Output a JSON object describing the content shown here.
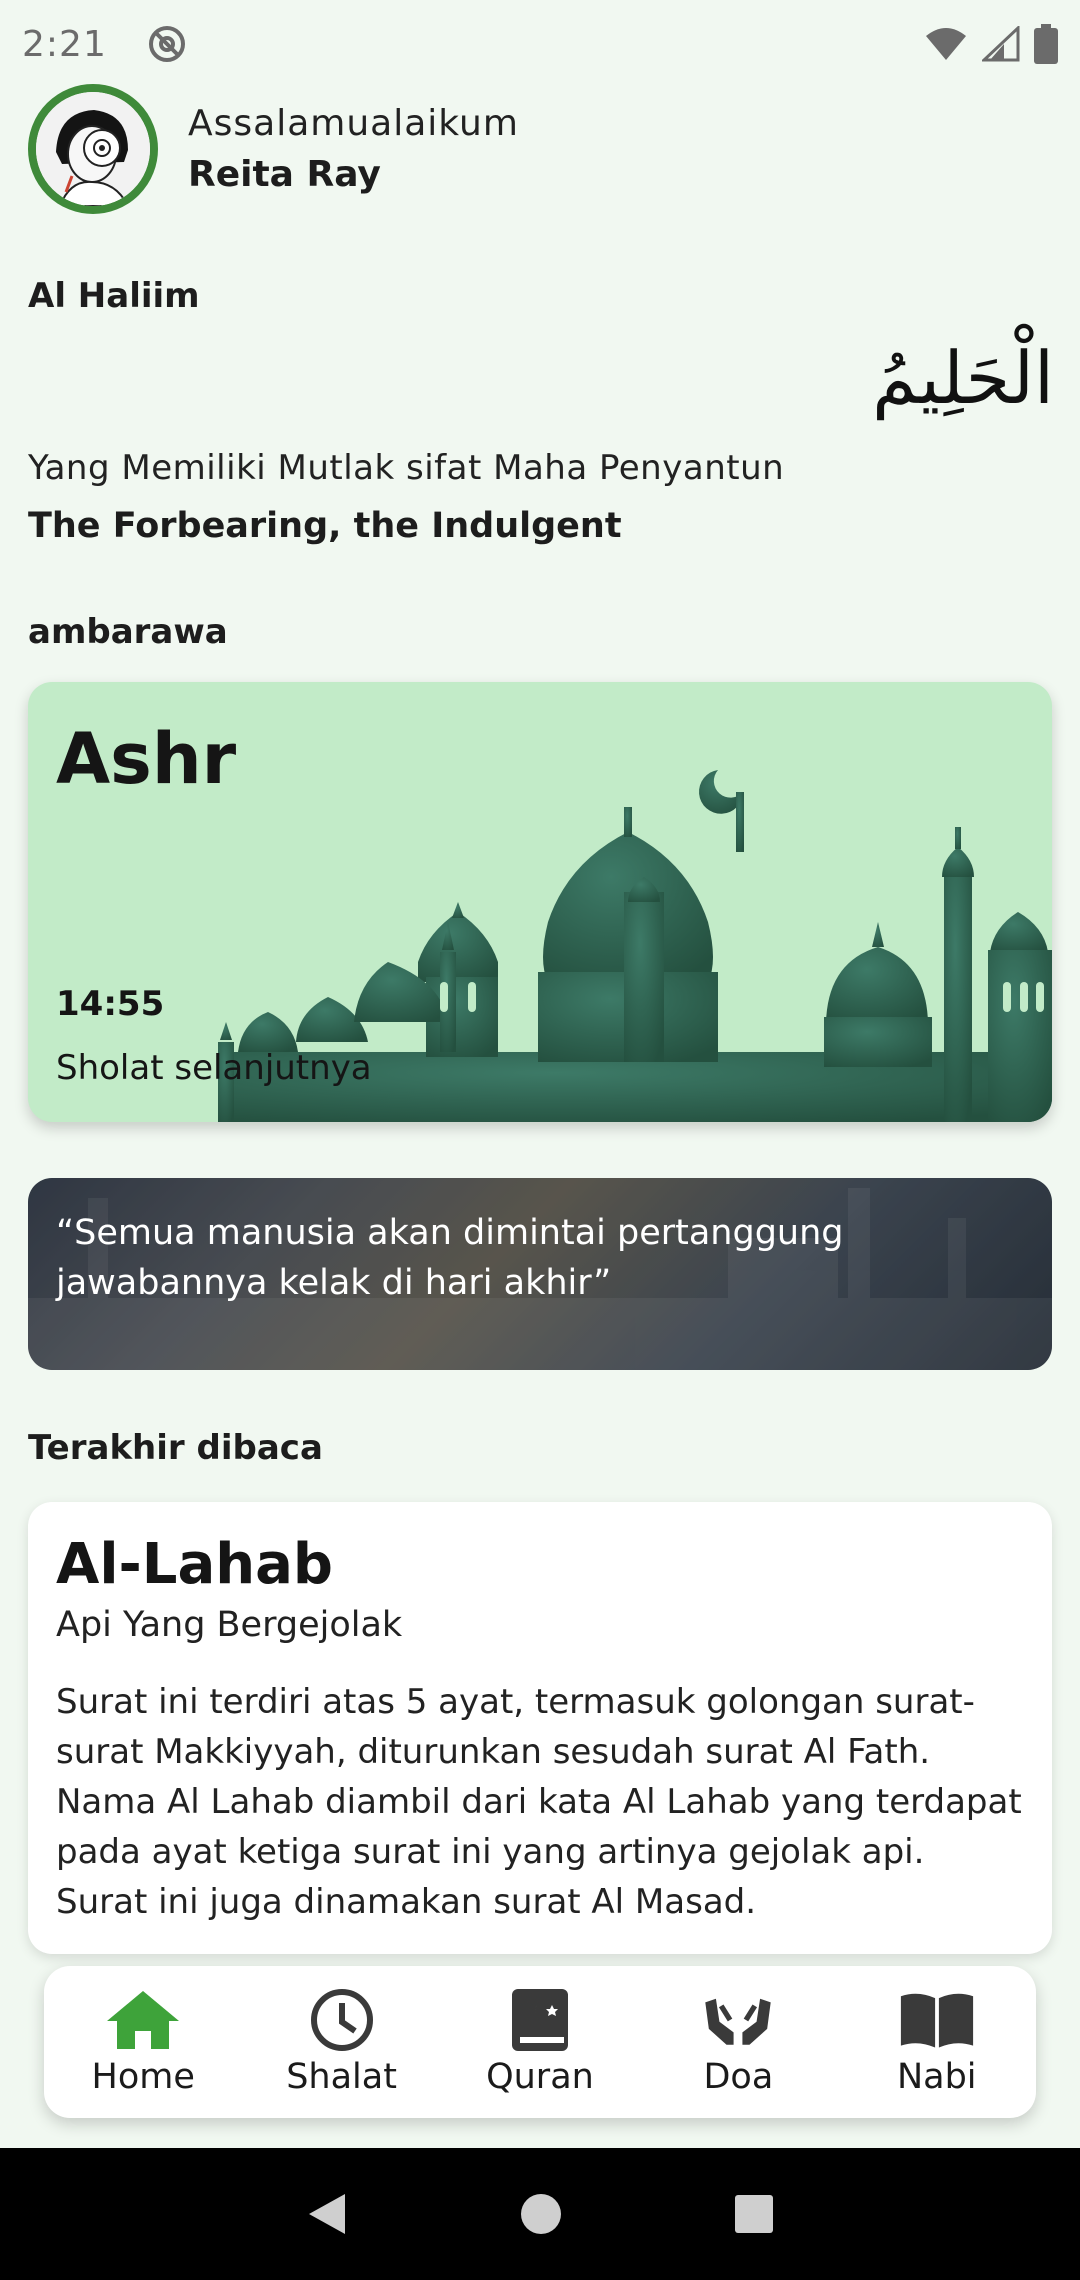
{
  "status": {
    "time": "2:21",
    "dnd_icon": "dnd-icon",
    "wifi_icon": "wifi-icon",
    "signal_icon": "signal-icon",
    "battery_icon": "battery-icon"
  },
  "header": {
    "greeting": "Assalamualaikum",
    "name": "Reita Ray"
  },
  "asma": {
    "title": "Al Haliim",
    "arabic": "الْحَلِيمُ",
    "meaning_id": "Yang Memiliki Mutlak sifat Maha Penyantun",
    "meaning_en": "The Forbearing, the Indulgent"
  },
  "location": "ambarawa",
  "prayer": {
    "name": "Ashr",
    "time": "14:55",
    "subtitle": "Sholat selanjutnya"
  },
  "quote": {
    "text": "“Semua manusia akan dimintai pertanggung jawabannya kelak di hari akhir”"
  },
  "last_read": {
    "label": "Terakhir dibaca",
    "surah": "Al-Lahab",
    "meaning": "Api Yang Bergejolak",
    "description": "Surat ini terdiri atas 5 ayat, termasuk golongan surat-surat Makkiyyah,  diturunkan sesudah surat Al Fath. Nama Al Lahab diambil dari kata  Al Lahab yang terdapat pada ayat ketiga surat ini yang artinya gejolak  api. Surat ini juga dinamakan surat Al Masad."
  },
  "nav": {
    "items": [
      {
        "label": "Home",
        "icon": "home-icon",
        "active": true
      },
      {
        "label": "Shalat",
        "icon": "clock-icon",
        "active": false
      },
      {
        "label": "Quran",
        "icon": "quran-icon",
        "active": false
      },
      {
        "label": "Doa",
        "icon": "praying-hands-icon",
        "active": false
      },
      {
        "label": "Nabi",
        "icon": "book-icon",
        "active": false
      }
    ]
  },
  "colors": {
    "accent": "#3ea33a",
    "background": "#f1f8f1",
    "prayer_card": "#c2ebc8",
    "mosque": "#2b5a4c"
  }
}
